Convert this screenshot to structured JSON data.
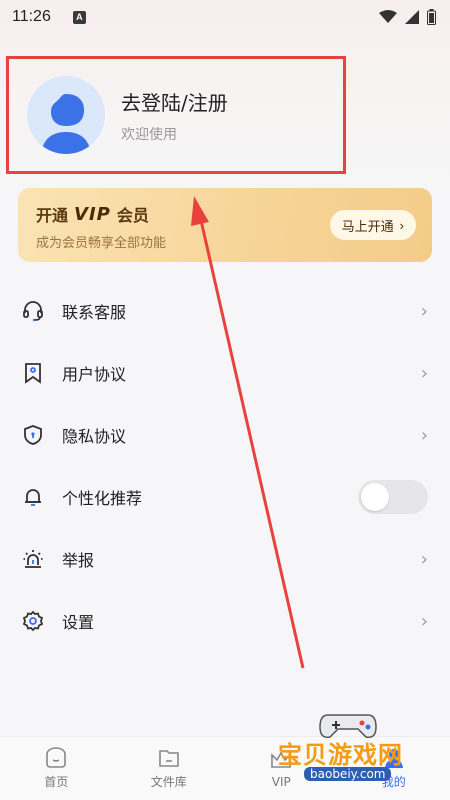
{
  "status": {
    "time": "11:26",
    "notify": "A"
  },
  "profile": {
    "title": "去登陆/注册",
    "subtitle": "欢迎使用"
  },
  "vip": {
    "prefix": "开通",
    "badge": "VIP",
    "suffix": "会员",
    "desc": "成为会员畅享全部功能",
    "button": "马上开通"
  },
  "menu": {
    "items": [
      {
        "label": "联系客服",
        "icon": "headset-icon"
      },
      {
        "label": "用户协议",
        "icon": "bookmark-icon"
      },
      {
        "label": "隐私协议",
        "icon": "shield-icon"
      },
      {
        "label": "个性化推荐",
        "icon": "bell-icon",
        "toggle": false
      },
      {
        "label": "举报",
        "icon": "alarm-icon"
      },
      {
        "label": "设置",
        "icon": "gear-icon"
      }
    ]
  },
  "nav": {
    "items": [
      "首页",
      "文件库",
      "VIP",
      "我的"
    ]
  },
  "watermark": {
    "title": "宝贝游戏网",
    "url": "baobeiy.com"
  },
  "colors": {
    "highlight": "#e8423e",
    "vip_gold": "#f6d497",
    "accent": "#3c6cf0"
  }
}
